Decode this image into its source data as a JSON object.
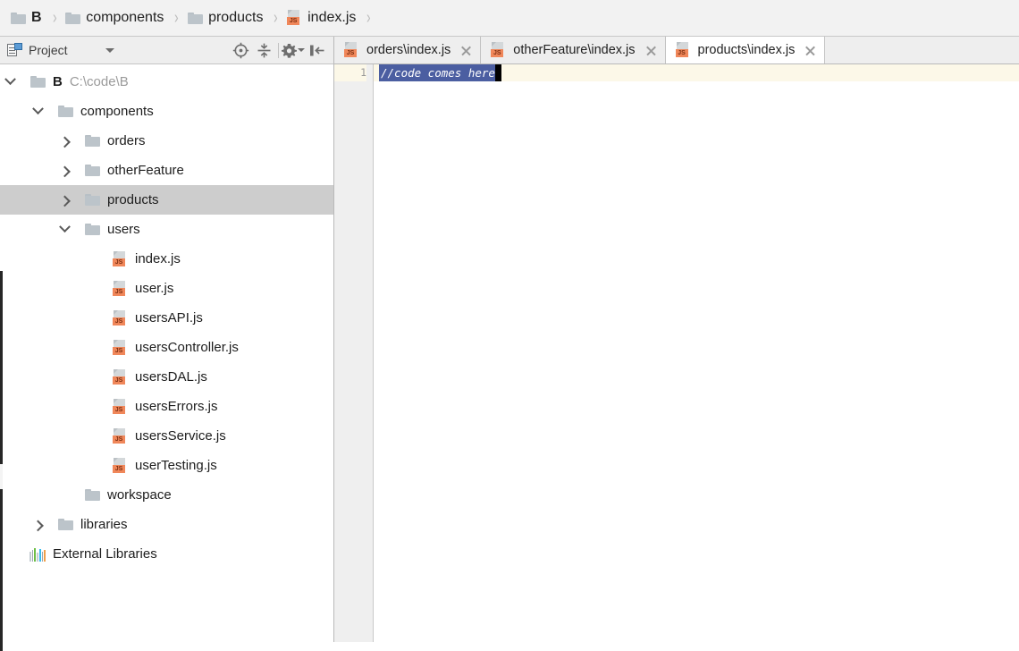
{
  "breadcrumb": {
    "items": [
      {
        "label": "B",
        "icon": "folder-icon",
        "bold": true
      },
      {
        "label": "components",
        "icon": "folder-icon",
        "bold": false
      },
      {
        "label": "products",
        "icon": "folder-icon",
        "bold": false
      },
      {
        "label": "index.js",
        "icon": "js-file-icon",
        "bold": false
      }
    ],
    "separator": "›"
  },
  "sidebar": {
    "toolbar": {
      "title": "Project",
      "title_icon": "project-view-icon",
      "dropdown_icon": "chevron-down-icon",
      "locate_icon": "scroll-from-source-icon",
      "collapse_icon": "collapse-all-icon",
      "settings_icon": "gear-icon",
      "settings_dropdown_icon": "chevron-down-icon",
      "hide_icon": "hide-panel-icon"
    },
    "tree": [
      {
        "depth": 0,
        "twisty": "down",
        "icon": "folder-icon",
        "label": "B",
        "bold": true,
        "sub": "C:\\code\\B",
        "selected": false
      },
      {
        "depth": 1,
        "twisty": "down",
        "icon": "folder-icon",
        "label": "components",
        "bold": false,
        "sub": "",
        "selected": false
      },
      {
        "depth": 2,
        "twisty": "right",
        "icon": "folder-icon",
        "label": "orders",
        "bold": false,
        "sub": "",
        "selected": false
      },
      {
        "depth": 2,
        "twisty": "right",
        "icon": "folder-icon",
        "label": "otherFeature",
        "bold": false,
        "sub": "",
        "selected": false
      },
      {
        "depth": 2,
        "twisty": "right",
        "icon": "folder-icon",
        "label": "products",
        "bold": false,
        "sub": "",
        "selected": true
      },
      {
        "depth": 2,
        "twisty": "down",
        "icon": "folder-icon",
        "label": "users",
        "bold": false,
        "sub": "",
        "selected": false
      },
      {
        "depth": 3,
        "twisty": "none",
        "icon": "js-file-icon",
        "label": "index.js",
        "bold": false,
        "sub": "",
        "selected": false
      },
      {
        "depth": 3,
        "twisty": "none",
        "icon": "js-file-icon",
        "label": "user.js",
        "bold": false,
        "sub": "",
        "selected": false
      },
      {
        "depth": 3,
        "twisty": "none",
        "icon": "js-file-icon",
        "label": "usersAPI.js",
        "bold": false,
        "sub": "",
        "selected": false
      },
      {
        "depth": 3,
        "twisty": "none",
        "icon": "js-file-icon",
        "label": "usersController.js",
        "bold": false,
        "sub": "",
        "selected": false
      },
      {
        "depth": 3,
        "twisty": "none",
        "icon": "js-file-icon",
        "label": "usersDAL.js",
        "bold": false,
        "sub": "",
        "selected": false
      },
      {
        "depth": 3,
        "twisty": "none",
        "icon": "js-file-icon",
        "label": "usersErrors.js",
        "bold": false,
        "sub": "",
        "selected": false
      },
      {
        "depth": 3,
        "twisty": "none",
        "icon": "js-file-icon",
        "label": "usersService.js",
        "bold": false,
        "sub": "",
        "selected": false
      },
      {
        "depth": 3,
        "twisty": "none",
        "icon": "js-file-icon",
        "label": "userTesting.js",
        "bold": false,
        "sub": "",
        "selected": false
      },
      {
        "depth": 2,
        "twisty": "none",
        "icon": "folder-icon",
        "label": "workspace",
        "bold": false,
        "sub": "",
        "selected": false
      },
      {
        "depth": 1,
        "twisty": "right",
        "icon": "folder-icon",
        "label": "libraries",
        "bold": false,
        "sub": "",
        "selected": false
      },
      {
        "depth": 0,
        "twisty": "none",
        "icon": "external-libraries-icon",
        "label": "External Libraries",
        "bold": false,
        "sub": "",
        "selected": false
      }
    ]
  },
  "editor": {
    "tabs": [
      {
        "label": "orders\\index.js",
        "icon": "js-file-icon",
        "active": false,
        "close_icon": "close-icon"
      },
      {
        "label": "otherFeature\\index.js",
        "icon": "js-file-icon",
        "active": false,
        "close_icon": "close-icon"
      },
      {
        "label": "products\\index.js",
        "icon": "js-file-icon",
        "active": true,
        "close_icon": "close-icon"
      }
    ],
    "lines": [
      {
        "number": "1",
        "text": "//code comes here"
      }
    ]
  },
  "colors": {
    "accent_js": "#f0875a",
    "selection": "#4b5ea1",
    "current_line": "#fcf8e8",
    "tree_selection": "#cdcdcd"
  }
}
